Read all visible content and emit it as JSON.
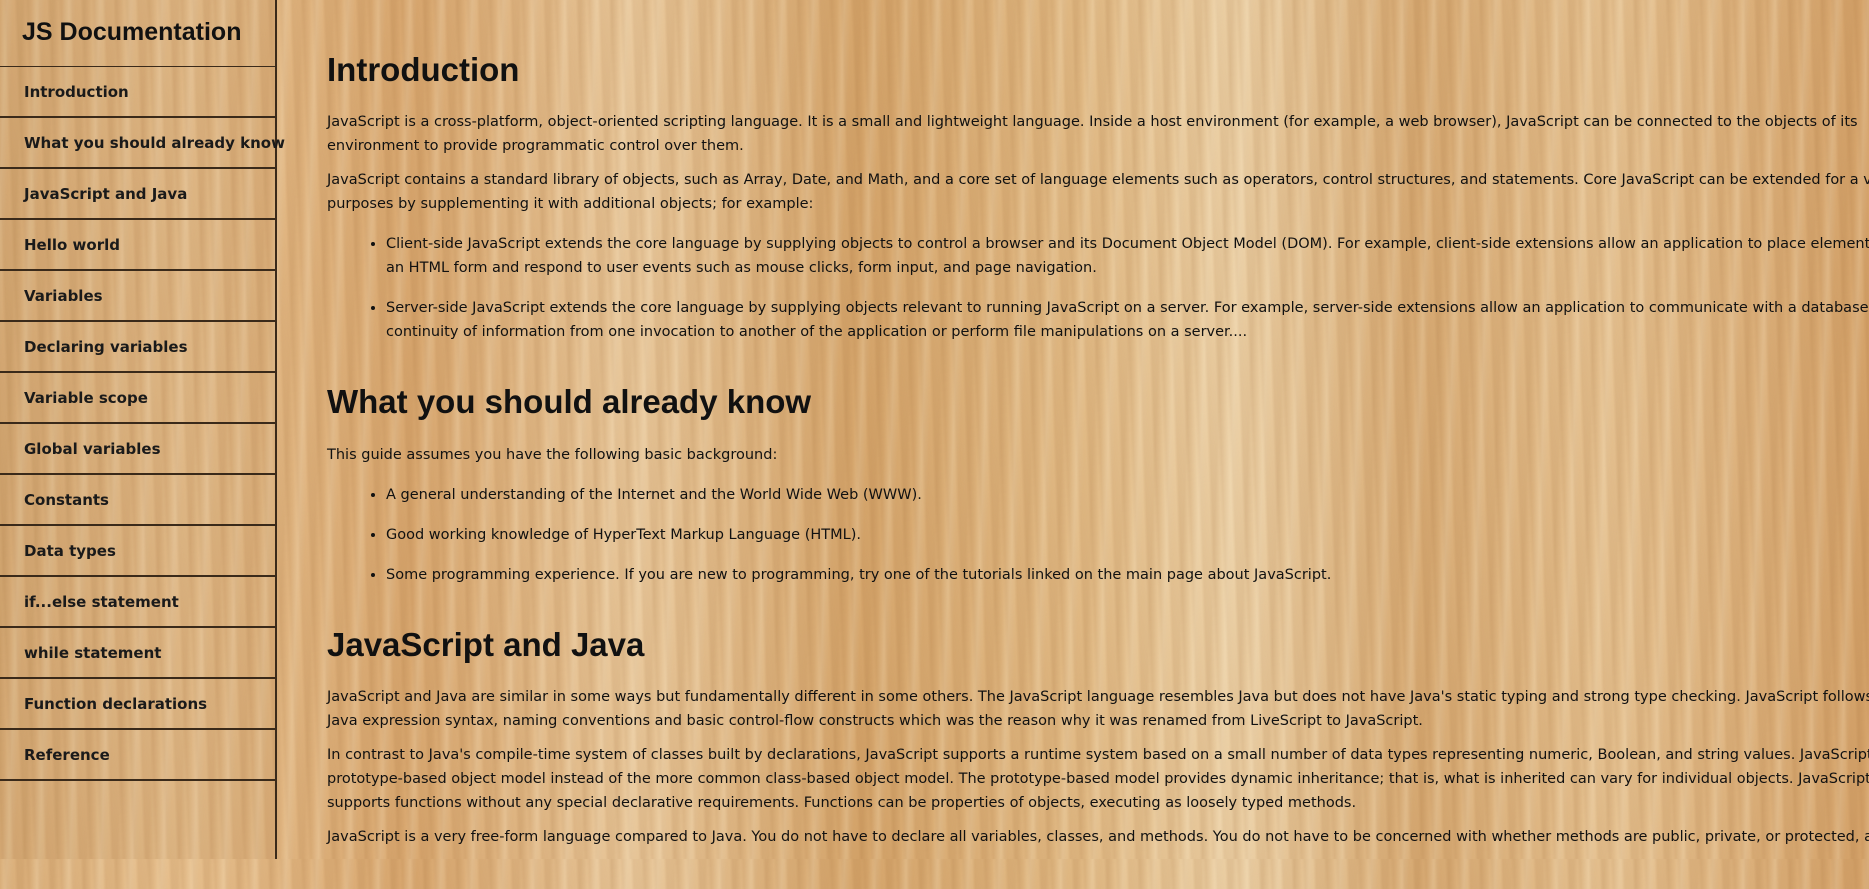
{
  "navbar": {
    "title": "JS Documentation",
    "items": [
      {
        "label": "Introduction"
      },
      {
        "label": "What you should already know"
      },
      {
        "label": "JavaScript and Java"
      },
      {
        "label": "Hello world"
      },
      {
        "label": "Variables"
      },
      {
        "label": "Declaring variables"
      },
      {
        "label": "Variable scope"
      },
      {
        "label": "Global variables"
      },
      {
        "label": "Constants"
      },
      {
        "label": "Data types"
      },
      {
        "label": "if...else statement"
      },
      {
        "label": "while statement"
      },
      {
        "label": "Function declarations"
      },
      {
        "label": "Reference"
      }
    ]
  },
  "sections": {
    "introduction": {
      "title": "Introduction",
      "p1_line1": "JavaScript is a cross-platform, object-oriented scripting language. It is a small and lightweight language. Inside a host environment (for example, a web browser), JavaScript can be connected to the objects of its",
      "p1_line2": "environment to provide programmatic control over them.",
      "p2_line1": "JavaScript contains a standard library of objects, such as Array, Date, and Math, and a core set of language elements such as operators, control structures, and statements. Core JavaScript can be extended for a variety of",
      "p2_line2": "purposes by supplementing it with additional objects; for example:",
      "li1_line1": "Client-side JavaScript extends the core language by supplying objects to control a browser and its Document Object Model (DOM). For example, client-side extensions allow an application to place elements on",
      "li1_line2": "an HTML form and respond to user events such as mouse clicks, form input, and page navigation.",
      "li2_line1": "Server-side JavaScript extends the core language by supplying objects relevant to running JavaScript on a server. For example, server-side extensions allow an application to communicate with a database, provide",
      "li2_line2": "continuity of information from one invocation to another of the application or perform file manipulations on a server...."
    },
    "know": {
      "title": "What you should already know",
      "p1": "This guide assumes you have the following basic background:",
      "li1": "A general understanding of the Internet and the World Wide Web (WWW).",
      "li2": "Good working knowledge of HyperText Markup Language (HTML).",
      "li3": "Some programming experience. If you are new to programming, try one of the tutorials linked on the main page about JavaScript."
    },
    "java": {
      "title": "JavaScript and Java",
      "p1_line1": "JavaScript and Java are similar in some ways but fundamentally different in some others. The JavaScript language resembles Java but does not have Java's static typing and strong type checking. JavaScript follows most",
      "p1_line2": "Java expression syntax, naming conventions and basic control-flow constructs which was the reason why it was renamed from LiveScript to JavaScript.",
      "p2_line1": "In contrast to Java's compile-time system of classes built by declarations, JavaScript supports a runtime system based on a small number of data types representing numeric, Boolean, and string values. JavaScript has a",
      "p2_line2": "prototype-based object model instead of the more common class-based object model. The prototype-based model provides dynamic inheritance; that is, what is inherited can vary for individual objects. JavaScript also",
      "p2_line3": "supports functions without any special declarative requirements. Functions can be properties of objects, executing as loosely typed methods.",
      "p3_line1": "JavaScript is a very free-form language compared to Java. You do not have to declare all variables, classes, and methods. You do not have to be concerned with whether methods are public, private, or protected, and you"
    }
  }
}
